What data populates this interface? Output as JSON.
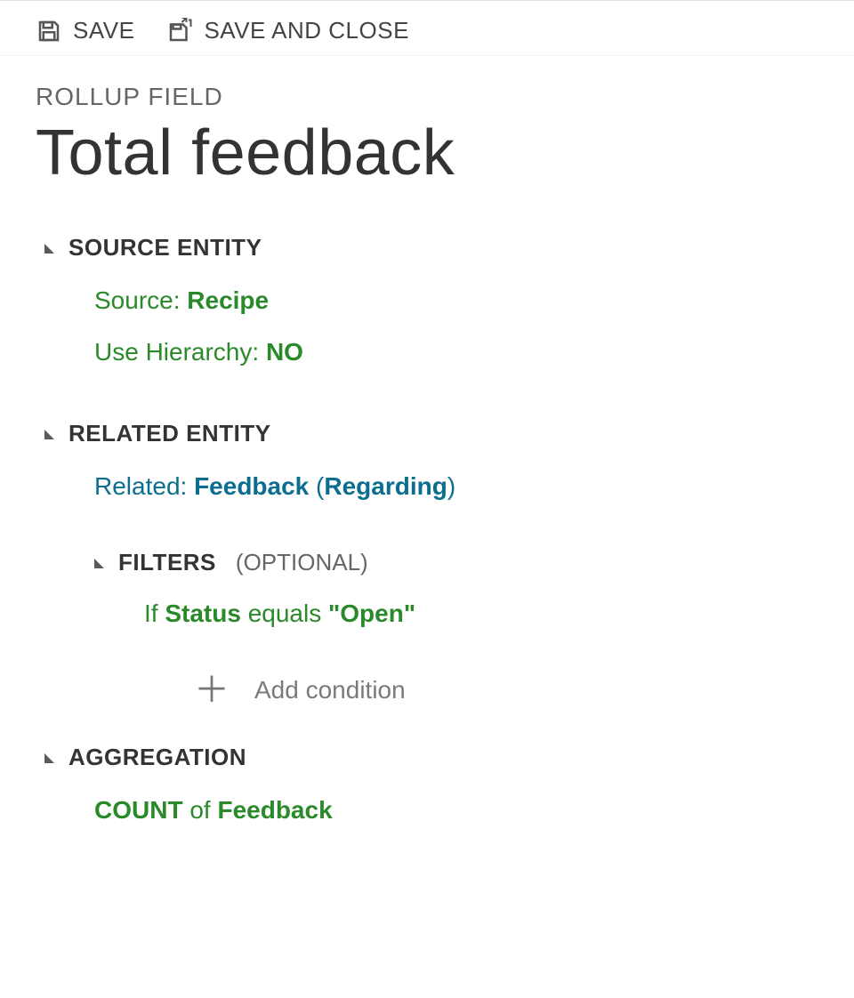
{
  "toolbar": {
    "save_label": "SAVE",
    "save_close_label": "SAVE AND CLOSE"
  },
  "header": {
    "breadcrumb": "ROLLUP FIELD",
    "title": "Total feedback"
  },
  "sections": {
    "source": {
      "heading": "SOURCE ENTITY",
      "source_label": "Source: ",
      "source_value": "Recipe",
      "hierarchy_label": "Use Hierarchy: ",
      "hierarchy_value": "NO"
    },
    "related": {
      "heading": "RELATED ENTITY",
      "related_label": "Related: ",
      "related_value": "Feedback",
      "related_paren_open": " (",
      "related_via": "Regarding",
      "related_paren_close": ")",
      "filters": {
        "heading": "FILTERS",
        "optional": "(OPTIONAL)",
        "if": "If ",
        "field": "Status",
        "op": " equals ",
        "value": "\"Open\"",
        "add_condition": "Add condition"
      }
    },
    "aggregation": {
      "heading": "AGGREGATION",
      "func": "COUNT",
      "of": " of ",
      "target": "Feedback"
    }
  }
}
